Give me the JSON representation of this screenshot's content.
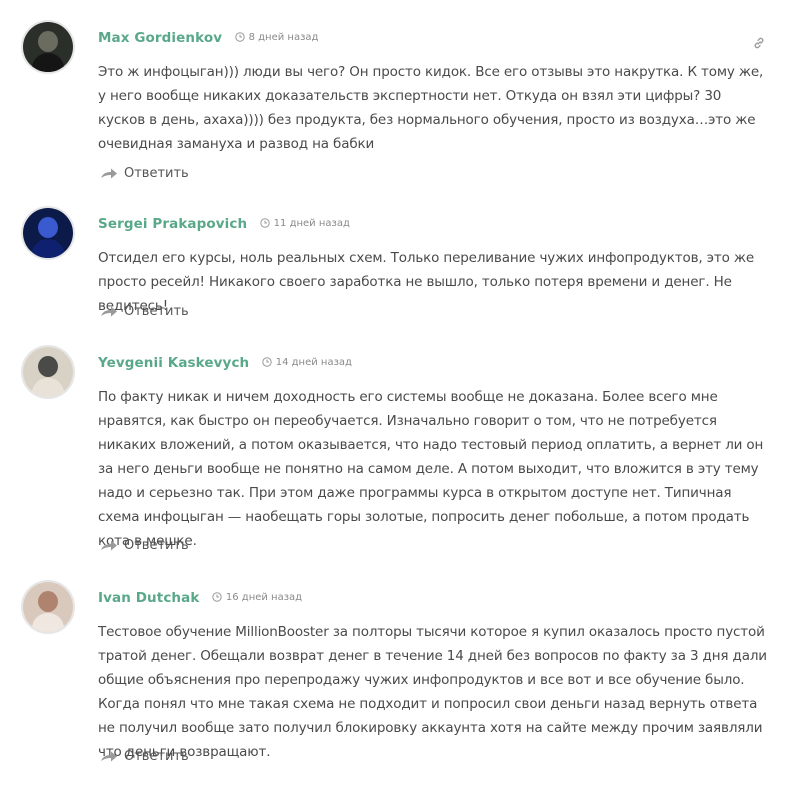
{
  "comments": [
    {
      "author": "Max Gordienkov",
      "time": "8 дней назад",
      "text": "Это ж инфоцыган))) люди вы чего? Он просто кидок. Все его отзывы это накрутка. К тому же, у него вообще никаких доказательств экспертности нет. Откуда он взял эти цифры? 30 кусков в день, ахаха)))) без продукта, без нормального обучения, просто из воздуха…это же очевидная замануха и развод на бабки",
      "reply": "Ответить",
      "avatar_colors": [
        "#2a2f2a",
        "#6b6b60",
        "#151515"
      ]
    },
    {
      "author": "Sergei Prakapovich",
      "time": "11 дней назад",
      "text": "Отсидел его курсы, ноль реальных схем. Только переливание чужих инфопродуктов, это же просто ресейл! Никакого своего заработка не вышло, только потеря времени и денег. Не ведитесь!",
      "reply": "Ответить",
      "avatar_colors": [
        "#0c1a4a",
        "#3a5ad0",
        "#102070"
      ]
    },
    {
      "author": "Yevgenii Kaskevych",
      "time": "14 дней назад",
      "text": "По факту никак и ничем доходность его системы вообще не доказана. Более всего мне нравятся, как быстро он переобучается. Изначально говорит о том, что не потребуется никаких вложений, а потом оказывается, что надо тестовый период оплатить, а вернет ли он за него деньги вообще не понятно на самом деле. А потом выходит, что вложится в эту тему надо и серьезно так. При этом даже программы курса в открытом доступе нет. Типичная схема инфоцыган — наобещать горы золотые, попросить денег побольше, а потом продать кота в мешке.",
      "reply": "Ответить",
      "avatar_colors": [
        "#d8d2c6",
        "#4a4a48",
        "#e8e2d8"
      ]
    },
    {
      "author": "Ivan Dutchak",
      "time": "16 дней назад",
      "text": "Тестовое обучение MillionBooster за полторы тысячи которое я купил оказалось просто пустой тратой денег. Обещали возврат денег в течение 14 дней без вопросов по факту за 3 дня дали общие объяснения про перепродажу чужих инфопродуктов и все вот и все обучение было. Когда понял что мне такая схема не подходит и попросил свои деньги назад вернуть ответа не получил вообще зато получил блокировку аккаунта хотя на сайте между прочим заявляли что деньги возвращают.",
      "reply": "Ответить",
      "avatar_colors": [
        "#d9c9bd",
        "#b0836e",
        "#efe7e0"
      ]
    }
  ]
}
